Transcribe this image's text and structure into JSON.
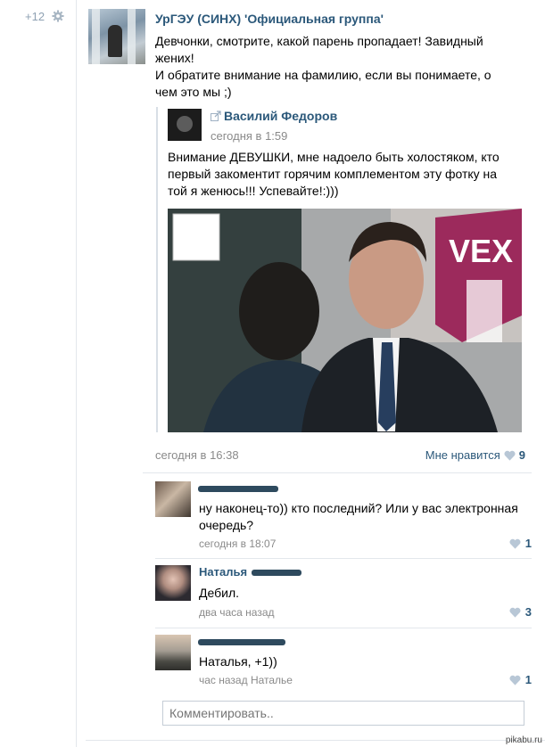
{
  "rating": "+12",
  "post": {
    "author": "УрГЭУ (СИНХ) 'Официальная группа'",
    "text_lines": [
      "Девчонки, смотрите, какой парень пропадает! Завидный",
      "жених!",
      "И обратите внимание на фамилию, если вы понимаете, о",
      "чем это мы ;)"
    ],
    "time": "сегодня в 16:38",
    "like_label": "Мне нравится",
    "like_count": "9"
  },
  "repost": {
    "author": "Василий Федоров",
    "time": "сегодня в 1:59",
    "text_lines": [
      "Внимание ДЕВУШКИ, мне надоело быть холостяком, кто",
      "первый закоментит горячим комплементом эту фотку на",
      "той я женюсь!!! Успевайте!:)))"
    ],
    "photo_sign": "VEX"
  },
  "comments": [
    {
      "name": "",
      "text_lines": [
        "ну наконец-то)) кто последний? Или у вас электронная",
        "очередь?"
      ],
      "time": "сегодня в 18:07",
      "likes": "1"
    },
    {
      "name": "Наталья",
      "text_lines": [
        "Дебил."
      ],
      "time": "два часа назад",
      "likes": "3"
    },
    {
      "name": "",
      "text_lines": [
        "Наталья, +1))"
      ],
      "time": "час назад Наталье",
      "likes": "1"
    }
  ],
  "comment_input": {
    "placeholder": "Комментировать.."
  },
  "watermark": "pikabu.ru",
  "colors": {
    "link": "#2b587a",
    "muted": "#8a8a8a",
    "heart": "#b8c7d6"
  }
}
